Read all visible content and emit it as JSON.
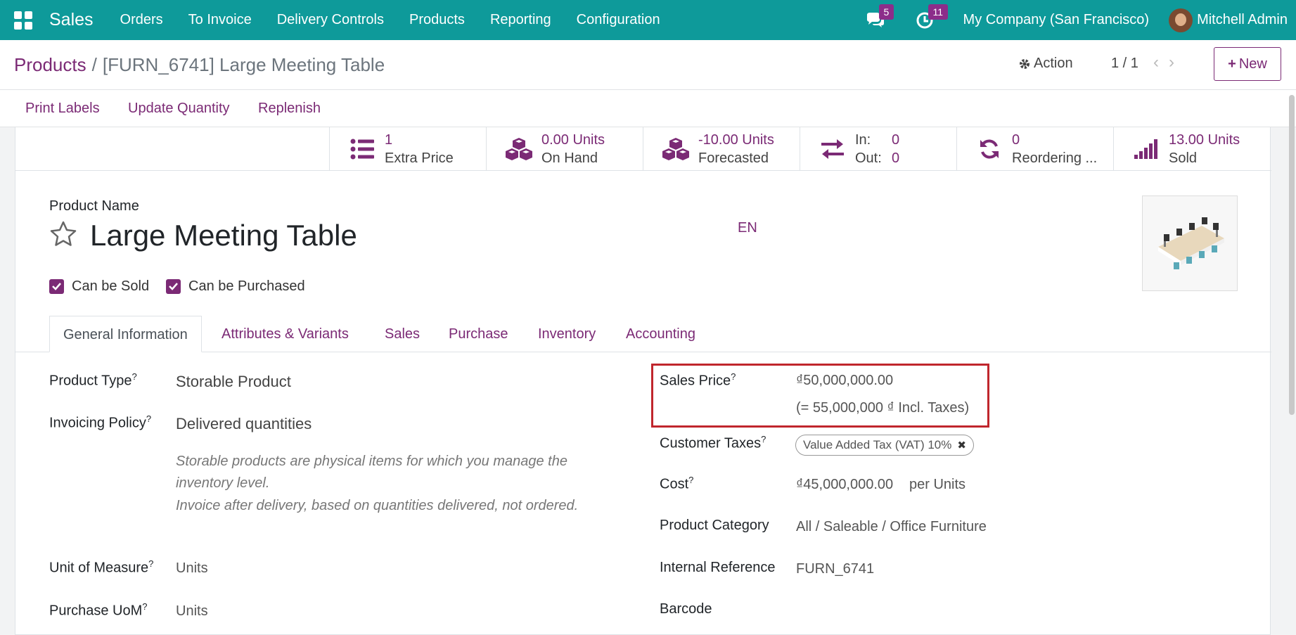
{
  "topnav": {
    "app_name": "Sales",
    "menu": [
      "Orders",
      "To Invoice",
      "Delivery Controls",
      "Products",
      "Reporting",
      "Configuration"
    ],
    "messages_count": "5",
    "activities_count": "11",
    "company": "My Company (San Francisco)",
    "user": "Mitchell Admin"
  },
  "control": {
    "breadcrumb_parent": "Products",
    "breadcrumb_sep": "/",
    "breadcrumb_current": "[FURN_6741] Large Meeting Table",
    "action_label": "Action",
    "pager": "1 / 1",
    "new_label": "New"
  },
  "statusbar": {
    "buttons": [
      "Print Labels",
      "Update Quantity",
      "Replenish"
    ]
  },
  "smart_buttons": {
    "extra_price": {
      "value": "1",
      "label": "Extra Price"
    },
    "on_hand": {
      "value": "0.00 Units",
      "label": "On Hand"
    },
    "forecasted": {
      "value": "-10.00 Units",
      "label": "Forecasted"
    },
    "inout": {
      "in_label": "In:",
      "in_value": "0",
      "out_label": "Out:",
      "out_value": "0"
    },
    "reordering": {
      "value": "0",
      "label": "Reordering ..."
    },
    "sold": {
      "value": "13.00 Units",
      "label": "Sold"
    }
  },
  "product": {
    "name_label": "Product Name",
    "name": "Large Meeting Table",
    "lang": "EN",
    "can_be_sold": "Can be Sold",
    "can_be_purchased": "Can be Purchased"
  },
  "tabs": [
    "General Information",
    "Attributes & Variants",
    "Sales",
    "Purchase",
    "Inventory",
    "Accounting"
  ],
  "general": {
    "product_type_label": "Product Type",
    "product_type": "Storable Product",
    "invoicing_policy_label": "Invoicing Policy",
    "invoicing_policy": "Delivered quantities",
    "help_storable": "Storable products are physical items for which you manage the inventory level.",
    "help_invoice": "Invoice after delivery, based on quantities delivered, not ordered.",
    "uom_label": "Unit of Measure",
    "uom": "Units",
    "purchase_uom_label": "Purchase UoM",
    "purchase_uom": "Units",
    "sales_price_label": "Sales Price",
    "sales_price": "₫50,000,000.00",
    "sales_price_incl": "(= 55,000,000 ₫ Incl. Taxes)",
    "customer_taxes_label": "Customer Taxes",
    "customer_tax_tag": "Value Added Tax (VAT) 10%",
    "cost_label": "Cost",
    "cost": "₫45,000,000.00",
    "cost_unit": "per Units",
    "category_label": "Product Category",
    "category": "All / Saleable / Office Furniture",
    "internal_ref_label": "Internal Reference",
    "internal_ref": "FURN_6741",
    "barcode_label": "Barcode",
    "help_mark": "?"
  }
}
